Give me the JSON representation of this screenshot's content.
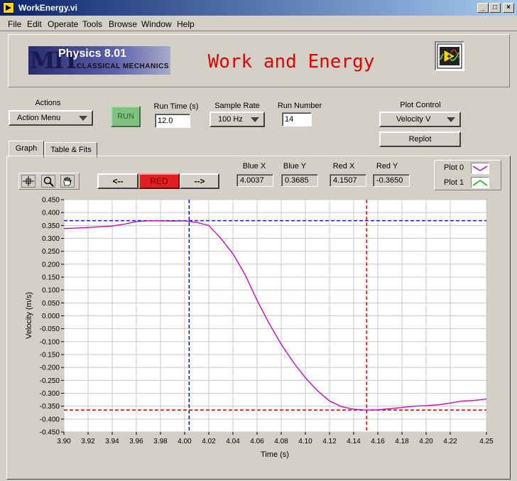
{
  "window": {
    "title": "WorkEnergy.vi",
    "controls": [
      "_",
      "□",
      "×"
    ]
  },
  "menu": [
    "File",
    "Edit",
    "Operate",
    "Tools",
    "Browse",
    "Window",
    "Help"
  ],
  "header": {
    "logo_mit": "MIT",
    "logo_title": "Physics 8.01",
    "logo_subtitle": "CLASSICAL MECHANICS",
    "app_title": "Work and Energy"
  },
  "controls": {
    "actions_label": "Actions",
    "actions_value": "Action Menu",
    "run_label": "RUN",
    "run_time_label": "Run Time (s)",
    "run_time_value": "12.0",
    "sample_rate_label": "Sample Rate",
    "sample_rate_value": "100 Hz",
    "run_number_label": "Run Number",
    "run_number_value": "14",
    "plot_control_label": "Plot Control",
    "plot_control_value": "Velocity V",
    "replot_label": "Replot"
  },
  "tabs": [
    {
      "label": "Graph",
      "active": true
    },
    {
      "label": "Table & Fits",
      "active": false
    }
  ],
  "cursors": {
    "left_label": "<--",
    "mode_label": "RED",
    "right_label": "-->",
    "blue_x_label": "Blue X",
    "blue_x_value": "4.0037",
    "blue_y_label": "Blue Y",
    "blue_y_value": "0.3685",
    "red_x_label": "Red X",
    "red_x_value": "4.1507",
    "red_y_label": "Red Y",
    "red_y_value": "-0.3650"
  },
  "legend": [
    {
      "name": "Plot 0",
      "color": "#c000c0"
    },
    {
      "name": "Plot 1",
      "color": "#00c000"
    }
  ],
  "colors": {
    "plot": "#c000c0",
    "blue_cursor": "#0000e0",
    "red_cursor": "#e00000",
    "run_button": "#80c080",
    "title": "#e00000"
  },
  "chart_data": {
    "type": "line",
    "xlabel": "Time (s)",
    "ylabel": "Velocity (m/s)",
    "xlim": [
      3.9,
      4.25
    ],
    "ylim": [
      -0.45,
      0.45
    ],
    "x_ticks": [
      "3.90",
      "3.92",
      "3.94",
      "3.96",
      "3.98",
      "4.00",
      "4.02",
      "4.04",
      "4.06",
      "4.08",
      "4.10",
      "4.12",
      "4.14",
      "4.16",
      "4.18",
      "4.20",
      "4.22",
      "4.25"
    ],
    "y_ticks": [
      "0.450",
      "0.400",
      "0.350",
      "0.300",
      "0.250",
      "0.200",
      "0.150",
      "0.100",
      "0.050",
      "0.000",
      "-0.050",
      "-0.100",
      "-0.150",
      "-0.200",
      "-0.250",
      "-0.300",
      "-0.350",
      "-0.400",
      "-0.450"
    ],
    "grid": true,
    "series": [
      {
        "name": "Plot 0",
        "x": [
          3.9,
          3.91,
          3.92,
          3.93,
          3.94,
          3.95,
          3.96,
          3.97,
          3.98,
          3.99,
          4.0,
          4.01,
          4.02,
          4.03,
          4.04,
          4.05,
          4.06,
          4.07,
          4.08,
          4.09,
          4.1,
          4.11,
          4.12,
          4.13,
          4.14,
          4.15,
          4.16,
          4.17,
          4.18,
          4.19,
          4.2,
          4.21,
          4.22,
          4.23,
          4.24,
          4.25
        ],
        "y": [
          0.338,
          0.34,
          0.342,
          0.345,
          0.348,
          0.355,
          0.365,
          0.368,
          0.368,
          0.367,
          0.368,
          0.362,
          0.35,
          0.3,
          0.24,
          0.16,
          0.06,
          -0.03,
          -0.11,
          -0.18,
          -0.24,
          -0.29,
          -0.33,
          -0.352,
          -0.362,
          -0.365,
          -0.364,
          -0.36,
          -0.355,
          -0.35,
          -0.348,
          -0.345,
          -0.338,
          -0.33,
          -0.328,
          -0.322
        ]
      }
    ],
    "cursors": [
      {
        "name": "Blue",
        "x": 4.0037,
        "y": 0.3685,
        "color": "#0000e0"
      },
      {
        "name": "Red",
        "x": 4.1507,
        "y": -0.365,
        "color": "#e00000"
      }
    ]
  }
}
